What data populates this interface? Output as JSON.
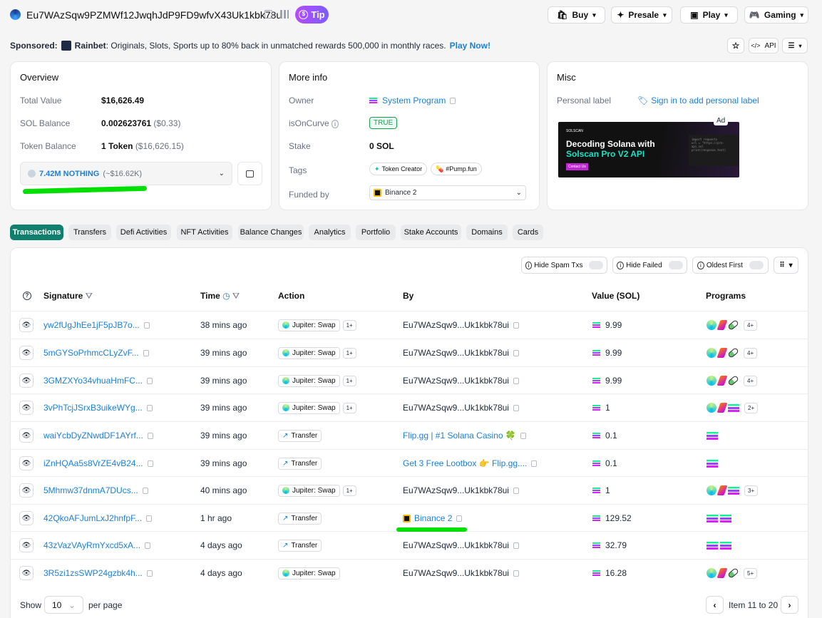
{
  "header": {
    "address": "Eu7WAzSqw9PZMWf12JwqhJdP9FD9wfvX43Uk1kbk78ui",
    "tip": "Tip",
    "nav": [
      "Buy",
      "Presale",
      "Play",
      "Gaming"
    ],
    "api": "API"
  },
  "sponsor": {
    "label": "Sponsored:",
    "brand": "Rainbet",
    "text": ": Originals, Slots, Sports up to 80% back in unmatched rewards 500,000 in monthly races.",
    "cta": "Play Now!"
  },
  "overview": {
    "title": "Overview",
    "rows": [
      {
        "label": "Total Value",
        "value": "$16,626.49",
        "sub": ""
      },
      {
        "label": "SOL Balance",
        "value": "0.002623761",
        "sub": "($0.33)"
      },
      {
        "label": "Token Balance",
        "value": "1 Token",
        "sub": "($16,626.15)"
      }
    ],
    "token": "7.42M NOTHING",
    "token_sub": "(~$16.62K)"
  },
  "moreinfo": {
    "title": "More info",
    "owner_label": "Owner",
    "owner": "System Program",
    "curve_label": "isOnCurve",
    "curve": "TRUE",
    "stake_label": "Stake",
    "stake": "0 SOL",
    "tags_label": "Tags",
    "tags": [
      "Token Creator",
      "#Pump.fun"
    ],
    "funded_label": "Funded by",
    "funded": "Binance 2"
  },
  "misc": {
    "title": "Misc",
    "label": "Personal label",
    "signin": "Sign in to add personal label",
    "ad": "Ad",
    "ad_brand": "SOLSCAN",
    "ad_line1": "Decoding Solana with",
    "ad_line2": "Solscan Pro V2 API",
    "ad_btn": "Contact Us",
    "ad_code": [
      "import requests",
      "url = \"https://pro-api.sol",
      "print(response.text)"
    ]
  },
  "tabs": [
    "Transactions",
    "Transfers",
    "Defi Activities",
    "NFT Activities",
    "Balance Changes",
    "Analytics",
    "Portfolio",
    "Stake Accounts",
    "Domains",
    "Cards"
  ],
  "filters": [
    "Hide Spam Txs",
    "Hide Failed",
    "Oldest First"
  ],
  "columns": {
    "signature": "Signature",
    "time": "Time",
    "action": "Action",
    "by": "By",
    "value": "Value (SOL)",
    "programs": "Programs"
  },
  "rows": [
    {
      "sig": "yw2fUgJhEe1jF5pJB7o...",
      "time": "38 mins ago",
      "action": "Jupiter: Swap",
      "plus": "1+",
      "by": "Eu7WAzSqw9...Uk1kbk78ui",
      "by_link": false,
      "value": "9.99",
      "prog": "jrp",
      "more": "4+"
    },
    {
      "sig": "5mGYSoPrhmcCLyZvF...",
      "time": "39 mins ago",
      "action": "Jupiter: Swap",
      "plus": "1+",
      "by": "Eu7WAzSqw9...Uk1kbk78ui",
      "by_link": false,
      "value": "9.99",
      "prog": "jrp",
      "more": "4+"
    },
    {
      "sig": "3GMZXYo34vhuaHmFC...",
      "time": "39 mins ago",
      "action": "Jupiter: Swap",
      "plus": "1+",
      "by": "Eu7WAzSqw9...Uk1kbk78ui",
      "by_link": false,
      "value": "9.99",
      "prog": "jrp",
      "more": "4+"
    },
    {
      "sig": "3vPhTcjJSrxB3uikeWYg...",
      "time": "39 mins ago",
      "action": "Jupiter: Swap",
      "plus": "1+",
      "by": "Eu7WAzSqw9...Uk1kbk78ui",
      "by_link": false,
      "value": "1",
      "prog": "jrs",
      "more": "2+"
    },
    {
      "sig": "waiYcbDyZNwdDF1AYrf...",
      "time": "39 mins ago",
      "action": "Transfer",
      "plus": "",
      "by": "Flip.gg | #1 Solana Casino 🍀",
      "by_link": true,
      "value": "0.1",
      "prog": "s",
      "more": ""
    },
    {
      "sig": "iZnHQAa5s8VrZE4vB24...",
      "time": "39 mins ago",
      "action": "Transfer",
      "plus": "",
      "by": "Get 3 Free Lootbox 👉 Flip.gg....",
      "by_link": true,
      "value": "0.1",
      "prog": "s",
      "more": ""
    },
    {
      "sig": "5Mhmw37dnmA7DUcs...",
      "time": "40 mins ago",
      "action": "Jupiter: Swap",
      "plus": "1+",
      "by": "Eu7WAzSqw9...Uk1kbk78ui",
      "by_link": false,
      "value": "1",
      "prog": "jrs",
      "more": "3+"
    },
    {
      "sig": "42QkoAFJumLxJ2hnfpF...",
      "time": "1 hr ago",
      "action": "Transfer",
      "plus": "",
      "by": "Binance 2",
      "by_link": true,
      "value": "129.52",
      "prog": "ss",
      "more": ""
    },
    {
      "sig": "43zVazVAyRmYxcd5xA...",
      "time": "4 days ago",
      "action": "Transfer",
      "plus": "",
      "by": "Eu7WAzSqw9...Uk1kbk78ui",
      "by_link": false,
      "value": "32.79",
      "prog": "ss",
      "more": ""
    },
    {
      "sig": "3R5zi1zsSWP24gzbk4h...",
      "time": "4 days ago",
      "action": "Jupiter: Swap",
      "plus": "",
      "by": "Eu7WAzSqw9...Uk1kbk78ui",
      "by_link": false,
      "value": "16.28",
      "prog": "jrp",
      "more": "5+"
    }
  ],
  "footer": {
    "show": "Show",
    "per_page_value": "10",
    "per_page": "per page",
    "items": "Item 11 to 20"
  }
}
